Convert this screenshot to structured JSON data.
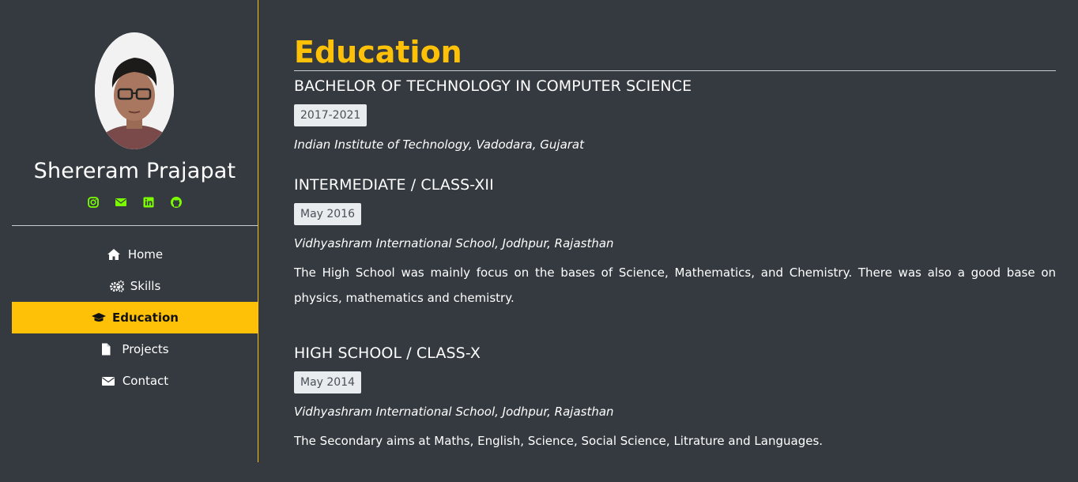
{
  "profile": {
    "name": "Shereram Prajapat"
  },
  "social": [
    {
      "icon": "instagram-icon"
    },
    {
      "icon": "email-icon"
    },
    {
      "icon": "linkedin-icon"
    },
    {
      "icon": "github-icon"
    }
  ],
  "nav": {
    "items": [
      {
        "label": "Home",
        "icon": "home-icon"
      },
      {
        "label": "Skills",
        "icon": "gears-icon"
      },
      {
        "label": "Education",
        "icon": "graduation-cap-icon",
        "active": true
      },
      {
        "label": "Projects",
        "icon": "file-icon"
      },
      {
        "label": "Contact",
        "icon": "envelope-icon"
      }
    ]
  },
  "education": {
    "title": "Education",
    "entries": [
      {
        "degree": "BACHELOR OF TECHNOLOGY IN COMPUTER SCIENCE",
        "date": "2017-2021",
        "school": "Indian Institute of Technology, Vadodara, Gujarat",
        "description": ""
      },
      {
        "degree": "INTERMEDIATE / CLASS-XII",
        "date": "May 2016",
        "school": "Vidhyashram International School, Jodhpur, Rajasthan",
        "description": "The High School was mainly focus on the bases of Science, Mathematics, and Chemistry. There was also a good base on physics, mathematics and chemistry."
      },
      {
        "degree": "HIGH SCHOOL / CLASS-X",
        "date": "May 2014",
        "school": "Vidhyashram International School, Jodhpur, Rajasthan",
        "description": "The Secondary aims at Maths, English, Science, Social Science, Litrature and Languages."
      }
    ]
  },
  "colors": {
    "background": "#343a40",
    "accent": "#ffc107",
    "social_icon": "#7cfc00",
    "badge_bg": "#e9ecef"
  }
}
